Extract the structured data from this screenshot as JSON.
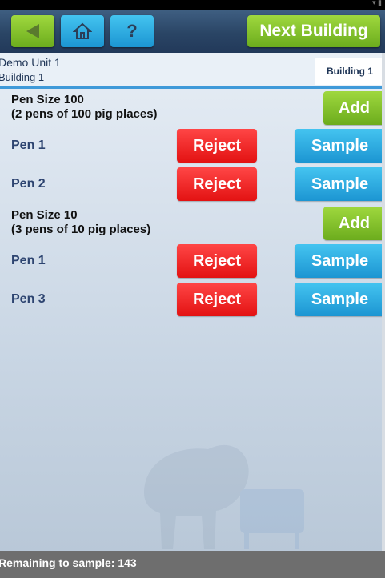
{
  "toolbar": {
    "next_label": "Next Building",
    "help_glyph": "?"
  },
  "header": {
    "unit": "Demo Unit 1",
    "building": "Building 1",
    "building_tab": "Building 1"
  },
  "groups": [
    {
      "title_line1": "Pen Size 100",
      "title_line2": "(2 pens of 100 pig places)",
      "add_label": "Add",
      "pens": [
        {
          "label": "Pen 1",
          "reject": "Reject",
          "sample": "Sample"
        },
        {
          "label": "Pen 2",
          "reject": "Reject",
          "sample": "Sample"
        }
      ]
    },
    {
      "title_line1": "Pen Size 10",
      "title_line2": "(3 pens of 10 pig places)",
      "add_label": "Add",
      "pens": [
        {
          "label": "Pen 1",
          "reject": "Reject",
          "sample": "Sample"
        },
        {
          "label": "Pen 3",
          "reject": "Reject",
          "sample": "Sample"
        }
      ]
    }
  ],
  "footer": {
    "remaining": "Remaining to sample: 143"
  },
  "icons": {
    "back": "back-arrow-icon",
    "home": "home-icon",
    "help": "help-icon"
  }
}
